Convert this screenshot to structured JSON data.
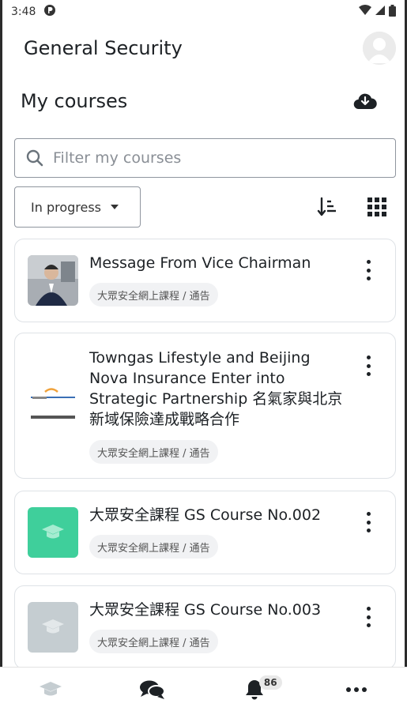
{
  "status_bar": {
    "time": "3:48"
  },
  "app_bar": {
    "title": "General Security"
  },
  "courses": {
    "heading": "My courses",
    "search_placeholder": "Filter my courses",
    "filter_selected": "In progress"
  },
  "course_list": [
    {
      "title": "Message From Vice Chairman",
      "category": "大眾安全網上課程 / 通告",
      "thumbnail": "photo"
    },
    {
      "title": "Towngas Lifestyle and Beijing Nova Insurance Enter into Strategic Partnership 名氣家與北京新域保險達成戰略合作",
      "category": "大眾安全網上課程 / 通告",
      "thumbnail": "logo"
    },
    {
      "title": "大眾安全課程 GS Course No.002",
      "category": "大眾安全網上課程 / 通告",
      "thumbnail": "graduation-cap",
      "thumb_color": "#3fcf9b"
    },
    {
      "title": "大眾安全課程 GS Course No.003",
      "category": "大眾安全網上課程 / 通告",
      "thumbnail": "graduation-cap",
      "thumb_color": "#c5cdd1"
    }
  ],
  "bottom_nav": {
    "notification_count": "86",
    "items": [
      "my-courses",
      "messages",
      "notifications",
      "more"
    ]
  },
  "colors": {
    "accent_green": "#3fcf9b",
    "muted_grey": "#c5cdd1",
    "active_tab": "#c5cdd1"
  }
}
